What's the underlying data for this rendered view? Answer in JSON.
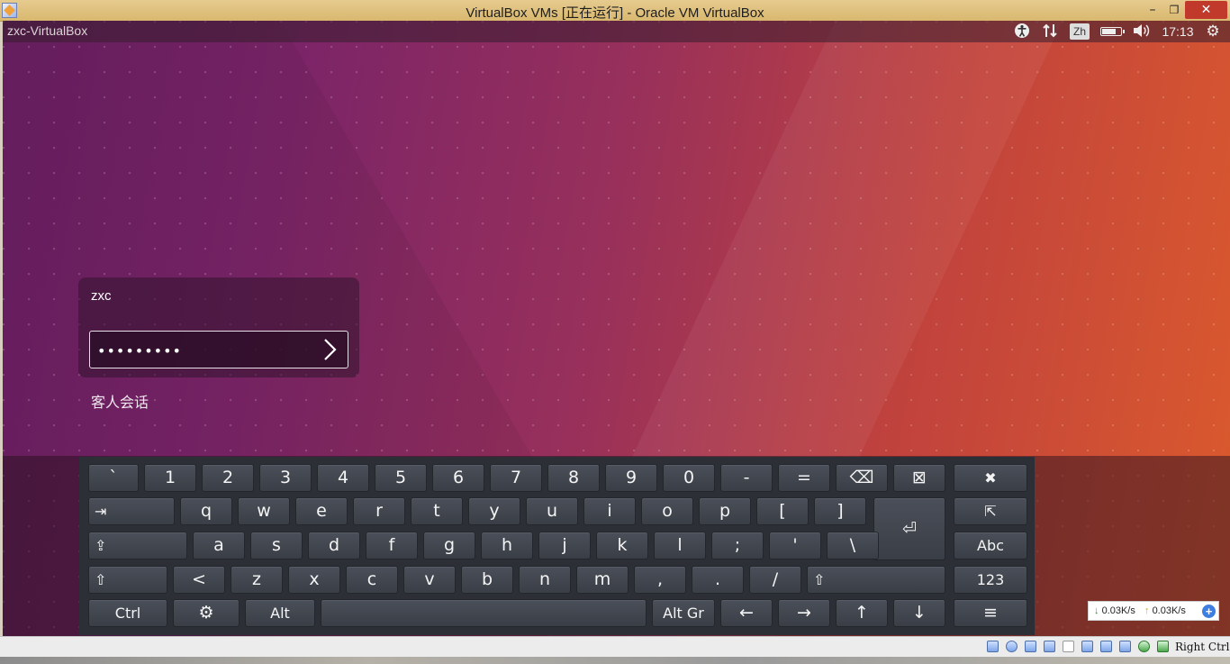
{
  "host_window": {
    "title": "VirtualBox VMs [正在运行] - Oracle VM VirtualBox",
    "min_glyph": "–",
    "max_glyph": "❐",
    "close_glyph": "✕"
  },
  "guest_panel": {
    "hostname": "zxc-VirtualBox",
    "input_method": "Zh",
    "clock": "17:13"
  },
  "login": {
    "username": "zxc",
    "password_value": "•••••••••",
    "guest_session_label": "客人会话"
  },
  "keyboard": {
    "rows": [
      [
        "`",
        "1",
        "2",
        "3",
        "4",
        "5",
        "6",
        "7",
        "8",
        "9",
        "0",
        "-",
        "=",
        "⌫",
        "⊠",
        "✖"
      ],
      [
        "⇥",
        "q",
        "w",
        "e",
        "r",
        "t",
        "y",
        "u",
        "i",
        "o",
        "p",
        "[",
        "]",
        "⏎",
        "⇱"
      ],
      [
        "⇪",
        "a",
        "s",
        "d",
        "f",
        "g",
        "h",
        "j",
        "k",
        "l",
        ";",
        "'",
        "\\",
        "Abc"
      ],
      [
        "⇧",
        "<",
        "z",
        "x",
        "c",
        "v",
        "b",
        "n",
        "m",
        ",",
        ".",
        "/",
        "⇧",
        "123"
      ],
      [
        "Ctrl",
        "⚙",
        "Alt",
        " ",
        "Alt Gr",
        "←",
        "→",
        "↑",
        "↓",
        "≡"
      ]
    ]
  },
  "speed_widget": {
    "download": "0.03K/s",
    "upload": "0.03K/s",
    "down_arrow": "↓",
    "up_arrow": "↑",
    "plus": "+"
  },
  "host_status": {
    "host_key": "Right Ctrl"
  },
  "colors": {
    "wallpaper_left": "#6a1f63",
    "wallpaper_right": "#db5a2d",
    "key_bg": "#3f434c",
    "close_button": "#c0392b"
  }
}
